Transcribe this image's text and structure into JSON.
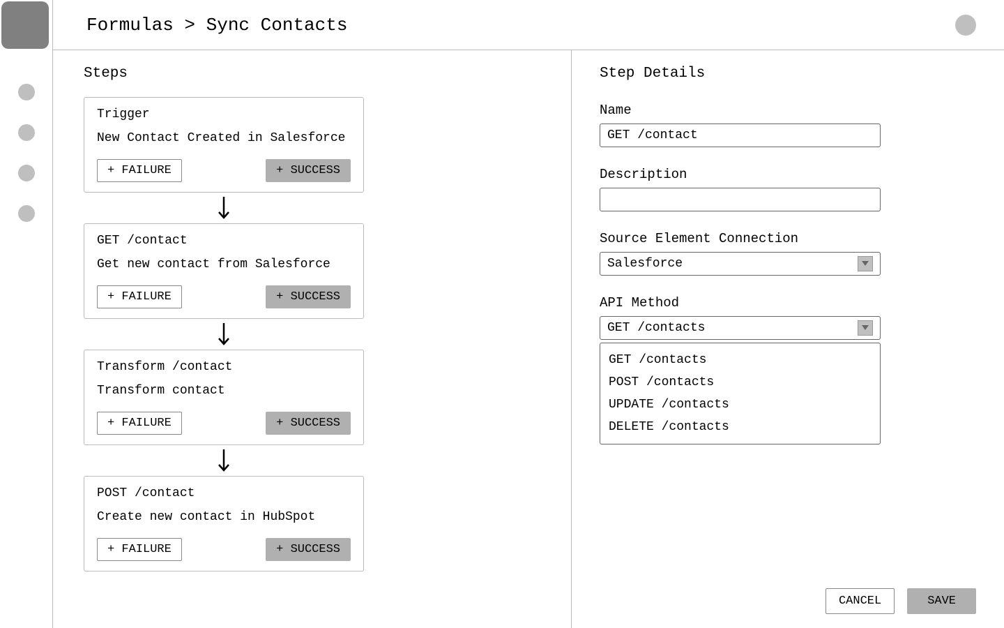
{
  "breadcrumb": "Formulas > Sync Contacts",
  "steps_panel": {
    "title": "Steps",
    "steps": [
      {
        "title": "Trigger",
        "desc": "New Contact Created in Salesforce",
        "failure": "+ FAILURE",
        "success": "+ SUCCESS"
      },
      {
        "title": "GET /contact",
        "desc": "Get new contact from Salesforce",
        "failure": "+ FAILURE",
        "success": "+ SUCCESS"
      },
      {
        "title": "Transform /contact",
        "desc": "Transform contact",
        "failure": "+ FAILURE",
        "success": "+ SUCCESS"
      },
      {
        "title": "POST /contact",
        "desc": "Create new contact in HubSpot",
        "failure": "+ FAILURE",
        "success": "+ SUCCESS"
      }
    ]
  },
  "details_panel": {
    "title": "Step Details",
    "name_label": "Name",
    "name_value": "GET /contact",
    "description_label": "Description",
    "description_value": "",
    "source_label": "Source Element Connection",
    "source_value": "Salesforce",
    "api_label": "API Method",
    "api_value": "GET /contacts",
    "api_options": [
      "GET /contacts",
      "POST /contacts",
      "UPDATE /contacts",
      "DELETE /contacts"
    ],
    "cancel": "CANCEL",
    "save": "SAVE"
  }
}
